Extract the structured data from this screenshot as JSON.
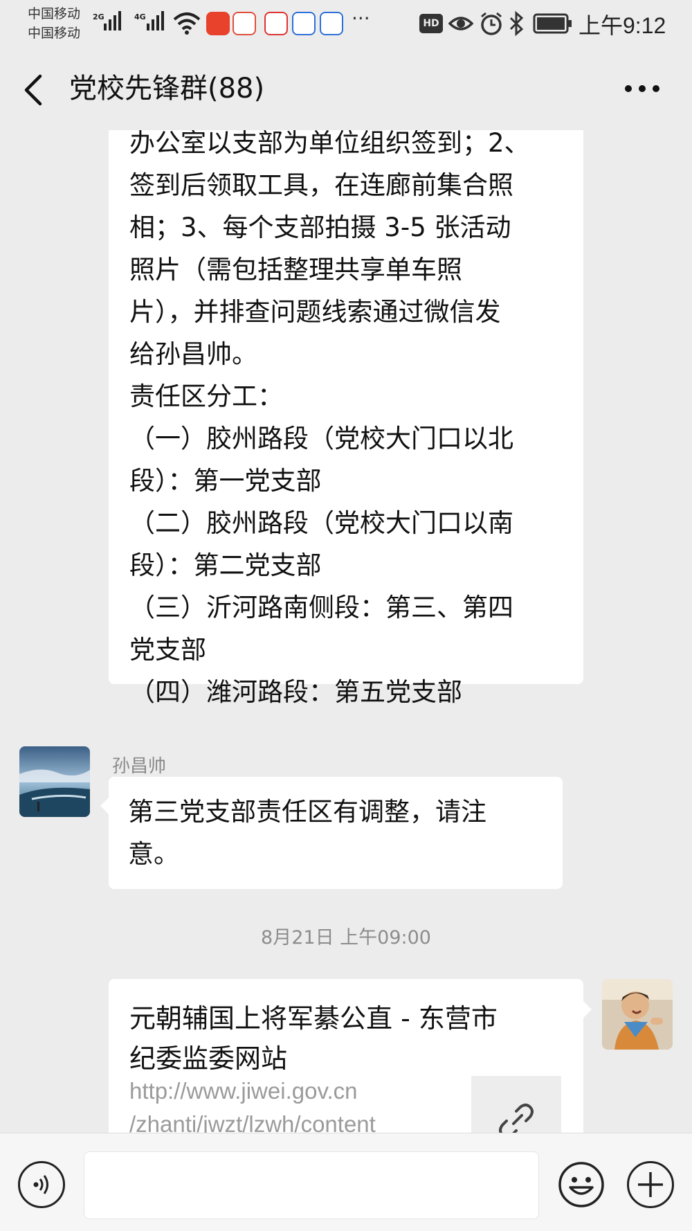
{
  "status_bar": {
    "carrier_1": "中国移动",
    "carrier_2": "中国移动",
    "network_1": "2G",
    "network_2": "4G",
    "hd_badge": "HD",
    "time": "上午9:12",
    "icons": [
      "signal-icon",
      "wifi-icon",
      "app-icon",
      "eye-icon",
      "alarm-icon",
      "bluetooth-icon",
      "battery-icon"
    ],
    "more_apps": "···"
  },
  "header": {
    "title": "党校先锋群(88)",
    "back_icon": "back-arrow-icon",
    "menu_icon": "more-icon"
  },
  "messages": [
    {
      "type": "text",
      "from": "other",
      "text": "办公室以支部为单位组织签到；2、\n签到后领取工具，在连廊前集合照\n相；3、每个支部拍摄 3-5 张活动\n照片（需包括整理共享单车照\n片），并排查问题线索通过微信发\n给孙昌帅。\n责任区分工：\n（一）胶州路段（党校大门口以北\n段）：第一党支部\n（二）胶州路段（党校大门口以南\n段）：第二党支部\n（三）沂河路南侧段：第三、第四\n党支部\n（四）潍河路段：第五党支部"
    },
    {
      "type": "text",
      "from": "other",
      "sender": "孙昌帅",
      "text": "第三党支部责任区有调整，请注\n意。"
    },
    {
      "type": "timestamp",
      "text": "8月21日 上午09:00"
    },
    {
      "type": "link",
      "from": "self",
      "title": "元朝辅国上将军綦公直 - 东营市\n纪委监委网站",
      "url": "http://www.jiwei.gov.cn\n/zhanti/jwzt/lzwh/content"
    }
  ],
  "input_bar": {
    "placeholder": "",
    "voice_icon": "voice-icon",
    "emoji_icon": "emoji-icon",
    "plus_icon": "plus-icon"
  },
  "colors": {
    "background": "#ececec",
    "bubble": "#ffffff",
    "timestamp": "#8c8c8c",
    "url": "#9a9a9a"
  }
}
